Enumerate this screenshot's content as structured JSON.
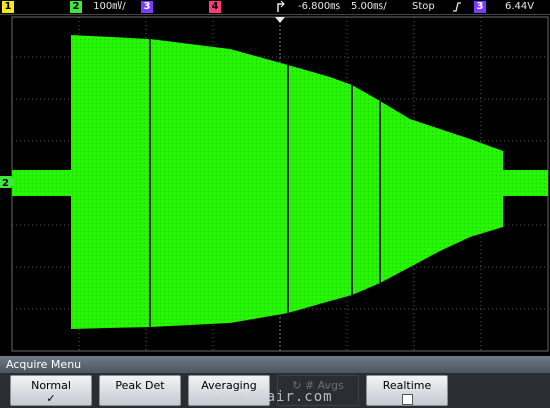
{
  "status_bar": {
    "ch1_num": "1",
    "ch2_num": "2",
    "ch2_scale": "100㎷/",
    "ch3_num": "3",
    "ch4_num": "4",
    "trigger_marker_icon": "trigger-position-icon",
    "time_offset": "-6.800㎳",
    "time_scale": "5.00㎳/",
    "run_state": "Stop",
    "trigger_slope_icon": "rising-edge-icon",
    "trigger_source": "3",
    "trigger_level": "6.44V",
    "colors": {
      "ch1": "#f5e623",
      "ch2": "#3ee83e",
      "ch3": "#7a3cff",
      "ch4": "#ff3a7a"
    }
  },
  "screen": {
    "ground_marker": "2",
    "trace_color": "#26f500"
  },
  "menu": {
    "title": "Acquire Menu",
    "keys": [
      {
        "label": "Normal",
        "sub": "✓",
        "enabled": true
      },
      {
        "label": "Peak Det",
        "sub": "",
        "enabled": true
      },
      {
        "label": "Averaging",
        "sub": "",
        "enabled": true
      },
      {
        "label": "# Avgs",
        "sub": "",
        "enabled": false,
        "icon": "rotate-knob-icon"
      },
      {
        "label": "Realtime",
        "sub": "",
        "enabled": true,
        "checkbox": true
      }
    ]
  },
  "watermark": "laserfair.com"
}
